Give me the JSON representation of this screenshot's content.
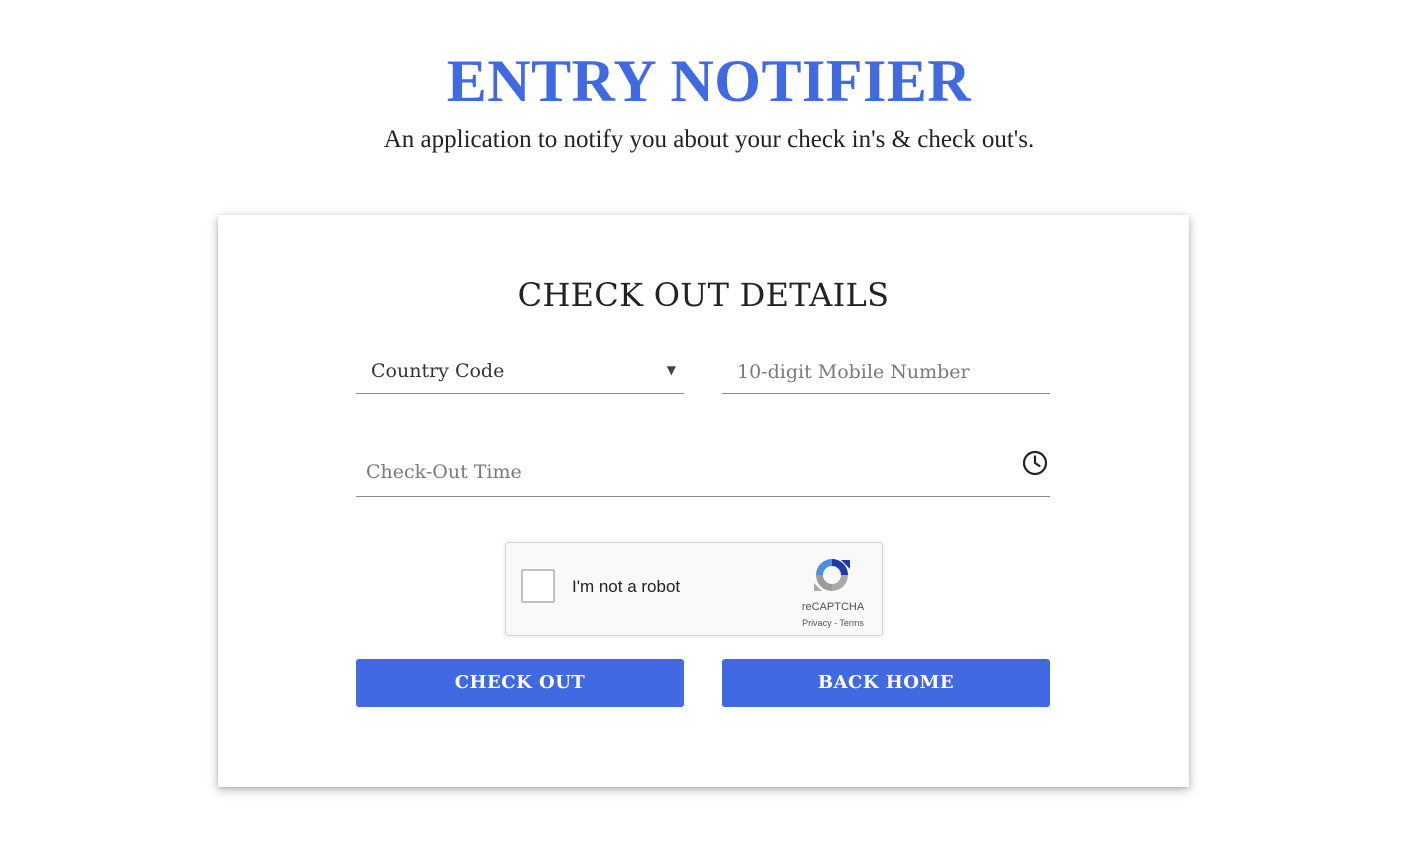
{
  "header": {
    "title": "ENTRY NOTIFIER",
    "subtitle": "An application to notify you about your check in's & check out's."
  },
  "form": {
    "title": "CHECK OUT DETAILS",
    "country_code": {
      "selected": "Country Code",
      "icon": "chevron-down-icon"
    },
    "mobile": {
      "value": "",
      "placeholder": "10-digit Mobile Number"
    },
    "checkout_time": {
      "value": "",
      "placeholder": "Check-Out Time",
      "icon": "clock-icon"
    },
    "recaptcha": {
      "label": "I'm not a robot",
      "brand": "reCAPTCHA",
      "privacy": "Privacy",
      "separator": " - ",
      "terms": "Terms"
    },
    "buttons": {
      "checkout": "CHECK OUT",
      "home": "BACK HOME"
    }
  },
  "colors": {
    "accent": "#4169e1",
    "text": "#222222",
    "underline": "#8a8a8a"
  }
}
